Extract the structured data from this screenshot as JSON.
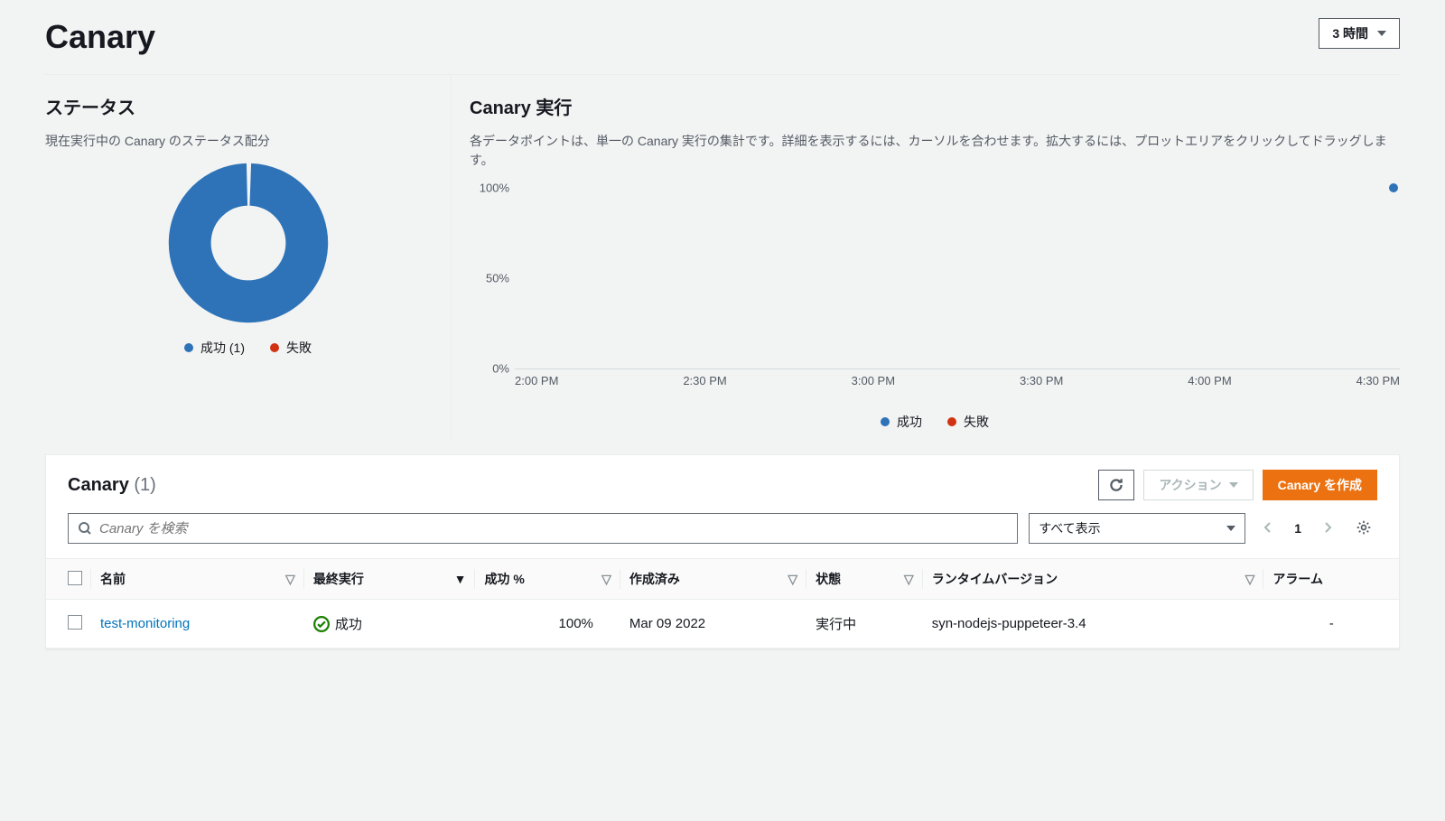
{
  "header": {
    "title": "Canary",
    "time_range_label": "3 時間"
  },
  "status_panel": {
    "title": "ステータス",
    "description": "現在実行中の Canary のステータス配分",
    "legend_success": "成功 (1)",
    "legend_fail": "失敗"
  },
  "runs_panel": {
    "title": "Canary 実行",
    "description": "各データポイントは、単一の Canary 実行の集計です。詳細を表示するには、カーソルを合わせます。拡大するには、プロットエリアをクリックしてドラッグします。",
    "legend_success": "成功",
    "legend_fail": "失敗"
  },
  "chart_data": {
    "donut": {
      "type": "pie",
      "categories": [
        "成功",
        "失敗"
      ],
      "values": [
        1,
        0
      ],
      "colors": [
        "#2e73b8",
        "#d13212"
      ]
    },
    "timeseries": {
      "type": "scatter",
      "ylabel": "",
      "ylim": [
        0,
        100
      ],
      "y_ticks": [
        "100%",
        "50%",
        "0%"
      ],
      "x_ticks": [
        "2:00 PM",
        "2:30 PM",
        "3:00 PM",
        "3:30 PM",
        "4:00 PM",
        "4:30 PM"
      ],
      "series": [
        {
          "name": "成功",
          "color": "#2e73b8",
          "points": [
            {
              "x": "4:30 PM",
              "y": 100
            }
          ]
        },
        {
          "name": "失敗",
          "color": "#d13212",
          "points": []
        }
      ]
    }
  },
  "list": {
    "title": "Canary",
    "count_display": "(1)",
    "refresh_label": "更新",
    "actions_label": "アクション",
    "create_label": "Canary を作成",
    "search_placeholder": "Canary を検索",
    "filter_select": "すべて表示",
    "page_number": "1"
  },
  "table": {
    "columns": {
      "name": "名前",
      "last_run": "最終実行",
      "success_pct": "成功 %",
      "created": "作成済み",
      "state": "状態",
      "runtime": "ランタイムバージョン",
      "alarm": "アラーム"
    },
    "rows": [
      {
        "name": "test-monitoring",
        "last_run_status": "成功",
        "success_pct": "100%",
        "created": "Mar 09 2022",
        "state": "実行中",
        "runtime": "syn-nodejs-puppeteer-3.4",
        "alarm": "-"
      }
    ]
  },
  "colors": {
    "success": "#2e73b8",
    "fail": "#d13212",
    "ok_green": "#1d8102",
    "primary": "#ec7211"
  }
}
